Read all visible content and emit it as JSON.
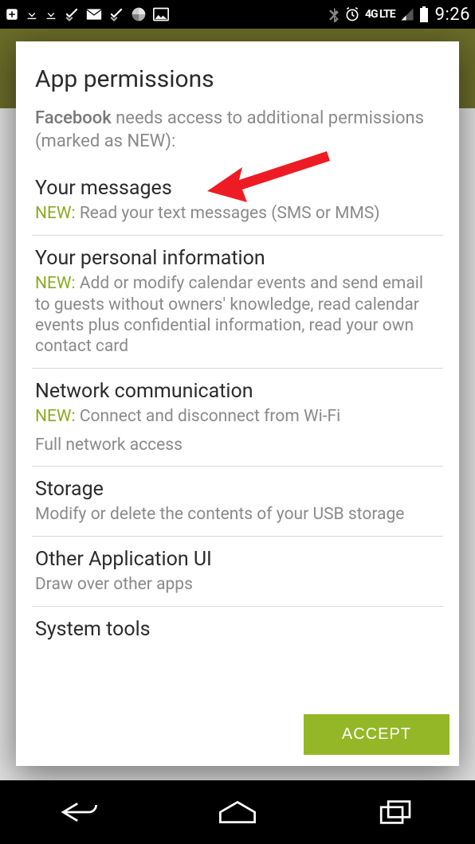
{
  "statusbar": {
    "time": "9:26",
    "net_label": "4G LTE"
  },
  "dialog": {
    "title": "App permissions",
    "app_name": "Facebook",
    "intro_suffix": " needs access to additional permissions (marked as NEW):",
    "new_label": "NEW:",
    "accept_label": "ACCEPT",
    "permissions": [
      {
        "title": "Your messages",
        "is_new": true,
        "desc": " Read your text messages (SMS or MMS)",
        "extra": ""
      },
      {
        "title": "Your personal information",
        "is_new": true,
        "desc": " Add or modify calendar events and send email to guests without owners' knowledge, read calendar events plus confidential information, read your own contact card",
        "extra": ""
      },
      {
        "title": "Network communication",
        "is_new": true,
        "desc": " Connect and disconnect from Wi-Fi",
        "extra": "Full network access"
      },
      {
        "title": "Storage",
        "is_new": false,
        "desc": "Modify or delete the contents of your USB storage",
        "extra": ""
      },
      {
        "title": "Other Application UI",
        "is_new": false,
        "desc": "Draw over other apps",
        "extra": ""
      },
      {
        "title": "System tools",
        "is_new": false,
        "desc": "",
        "extra": ""
      }
    ]
  }
}
